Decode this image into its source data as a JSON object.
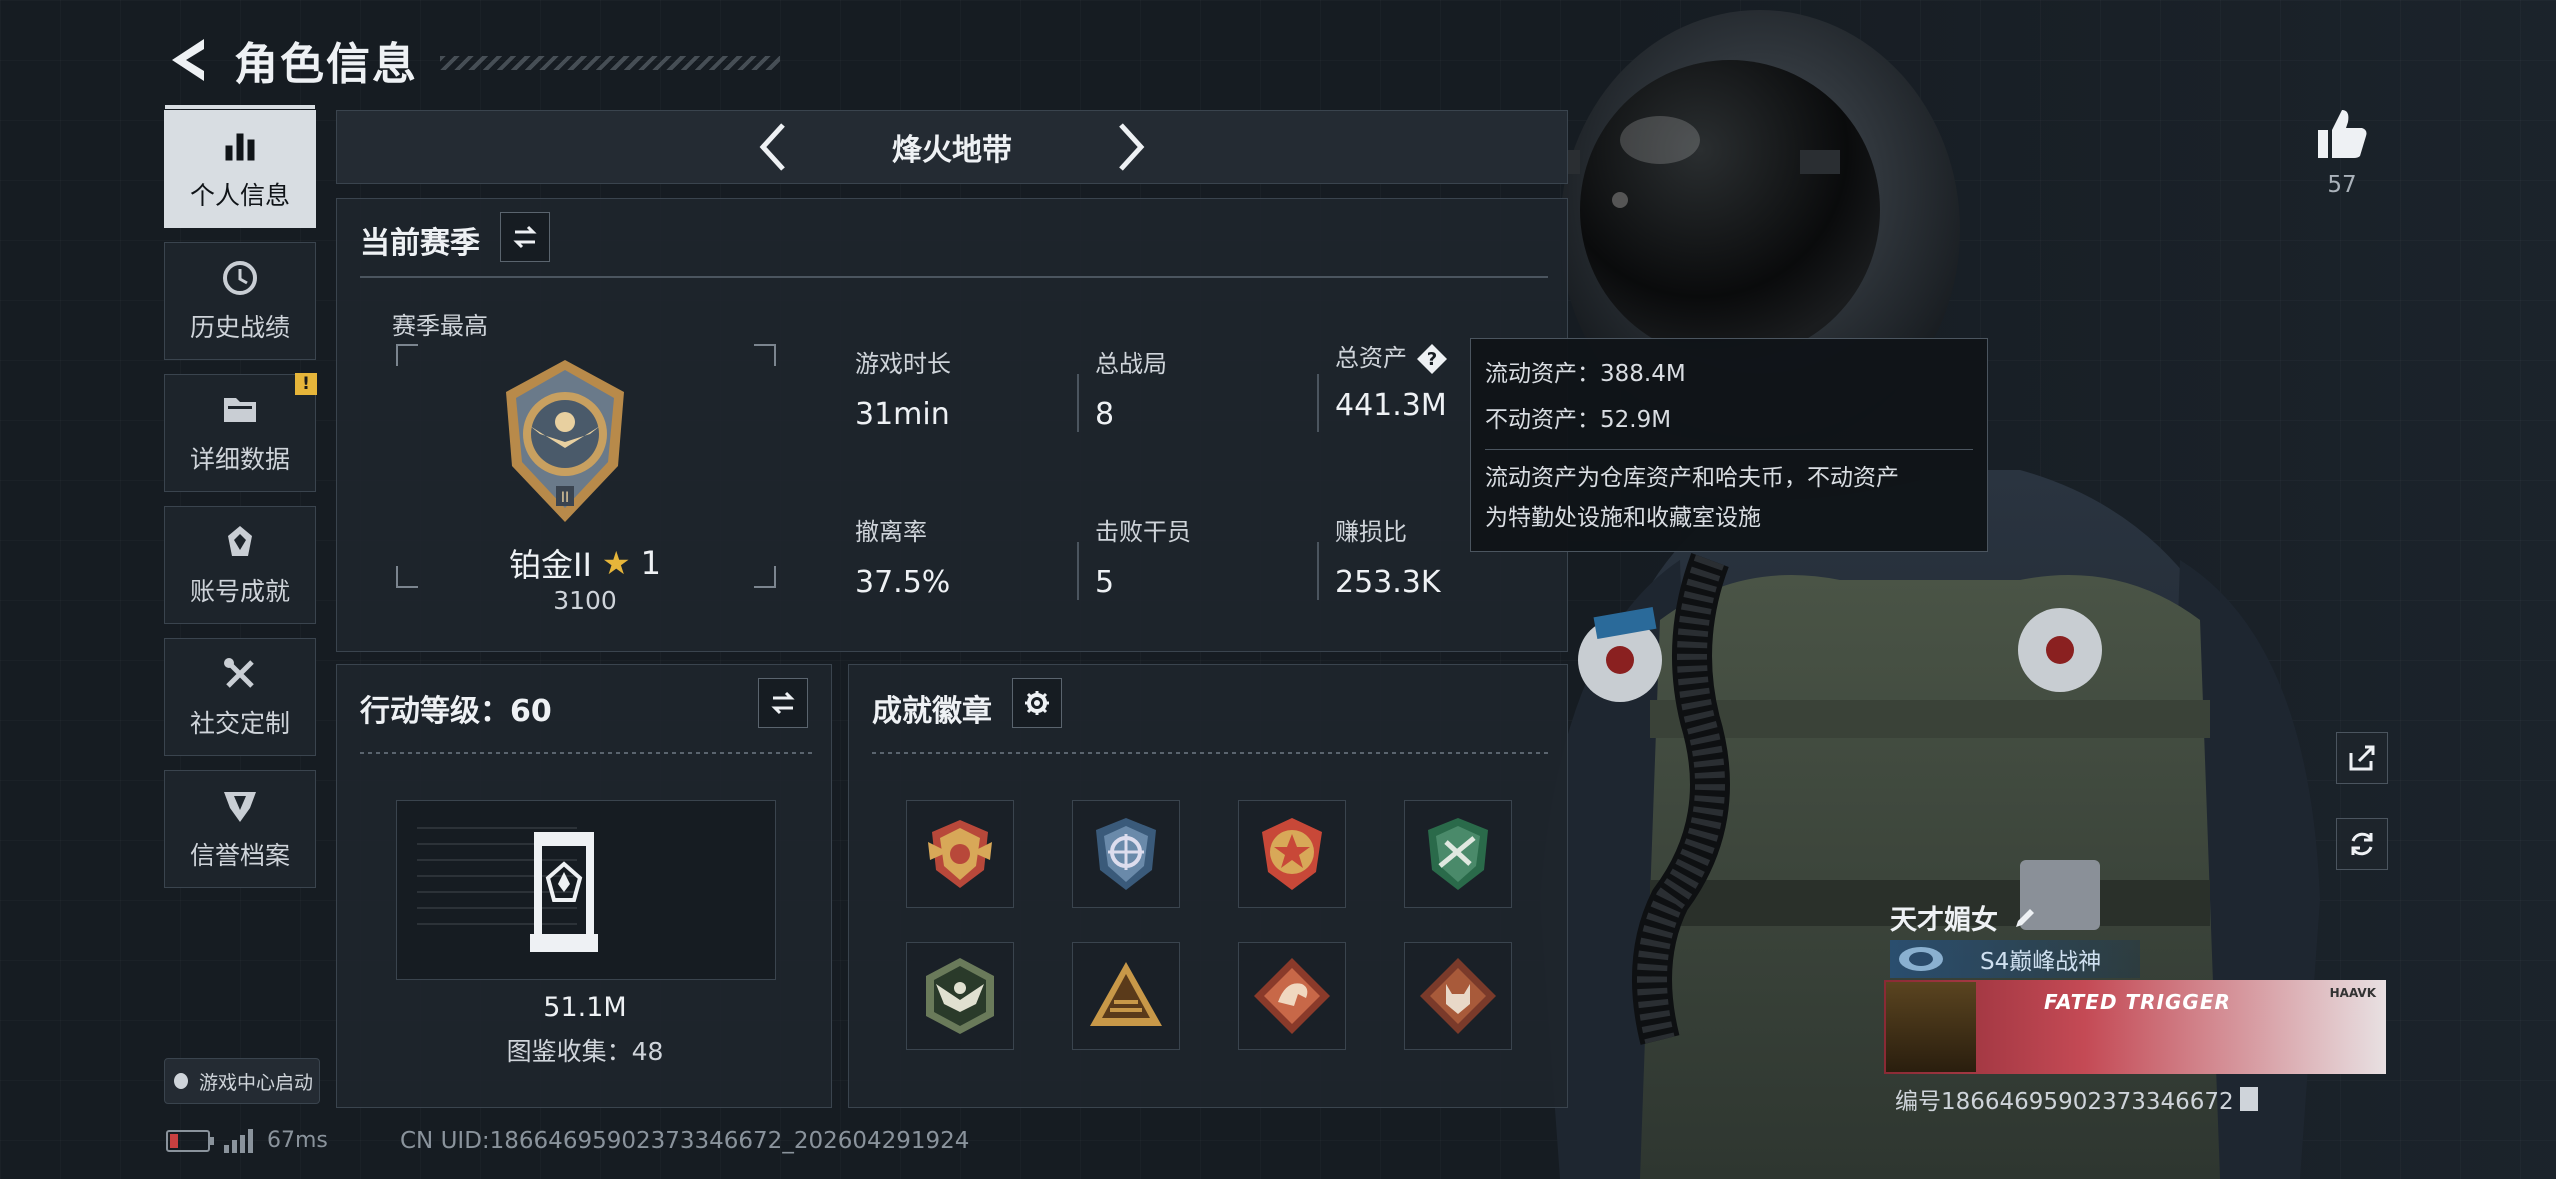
{
  "header": {
    "title": "角色信息"
  },
  "nav": {
    "items": [
      {
        "label": "个人信息",
        "icon": "bar-chart-icon",
        "active": true
      },
      {
        "label": "历史战绩",
        "icon": "history-clock-icon",
        "active": false
      },
      {
        "label": "详细数据",
        "icon": "folder-icon",
        "active": false,
        "badge": "!"
      },
      {
        "label": "账号成就",
        "icon": "medal-icon",
        "active": false
      },
      {
        "label": "社交定制",
        "icon": "tools-icon",
        "active": false
      },
      {
        "label": "信誉档案",
        "icon": "shield-emblem-icon",
        "active": false
      }
    ],
    "launch_label": "游戏中心启动"
  },
  "status": {
    "ping": "67ms",
    "uid": "CN UID:18664695902373346672_202604291924"
  },
  "mode": {
    "title": "烽火地带"
  },
  "season": {
    "title": "当前赛季",
    "best_label": "赛季最高",
    "rank_name": "铂金II",
    "rank_stars": "1",
    "rank_score": "3100",
    "stats": [
      {
        "label": "游戏时长",
        "value": "31min"
      },
      {
        "label": "总战局",
        "value": "8"
      },
      {
        "label": "总资产",
        "value": "441.3M"
      },
      {
        "label": "撤离率",
        "value": "37.5%"
      },
      {
        "label": "击败干员",
        "value": "5"
      },
      {
        "label": "赚损比",
        "value": "253.3K"
      }
    ]
  },
  "tooltip": {
    "liquid": "流动资产：388.4M",
    "fixed": "不动资产：52.9M",
    "note_line1": "流动资产为仓库资产和哈夫币，不动资产",
    "note_line2": "为特勤处设施和收藏室设施"
  },
  "action_level": {
    "title": "行动等级：60",
    "value": "51.1M",
    "collection": "图鉴收集：48"
  },
  "achievements": {
    "title": "成就徽章",
    "badges": [
      "winged-shield-badge",
      "crosshair-shield-badge",
      "star-shield-badge",
      "rifle-shield-badge",
      "eagle-hex-badge",
      "pyramid-badge",
      "dragon-diamond-badge",
      "wolf-diamond-badge"
    ]
  },
  "profile": {
    "likes": "57",
    "player_name": "天才媚女",
    "player_title": "S4巅峰战神",
    "card_text": "FATED TRIGGER",
    "card_brand": "HAAVK",
    "serial": "编号18664695902373346672"
  },
  "colors": {
    "accent_gold": "#e6b53a",
    "panel_bg": "#1e252c",
    "text_primary": "#eef1f4"
  }
}
